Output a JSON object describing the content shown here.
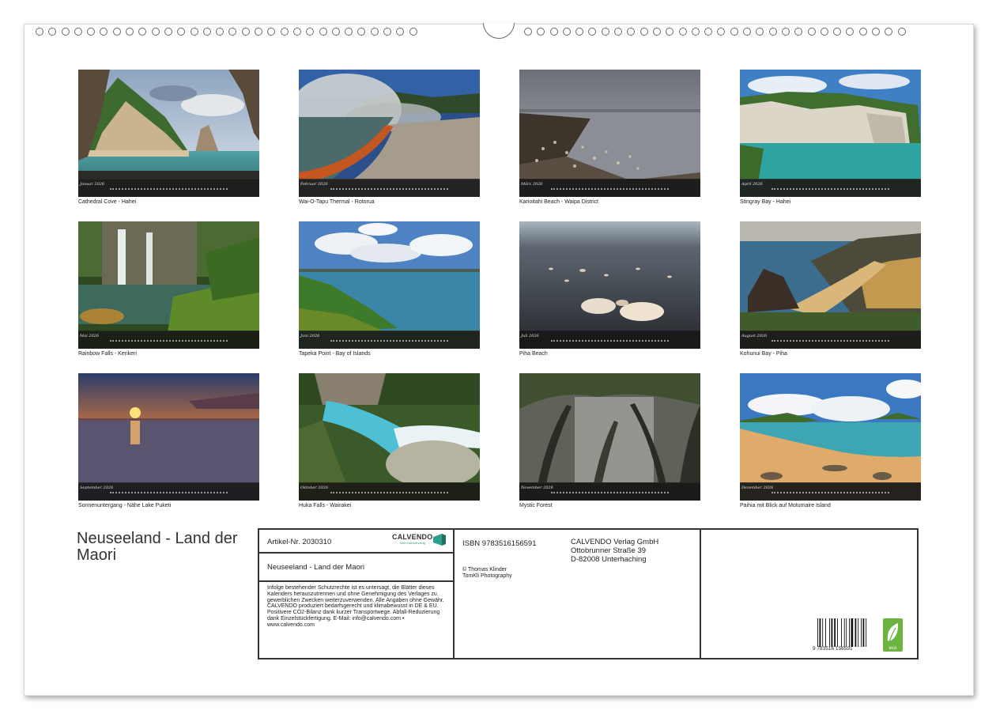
{
  "photos": [
    {
      "month": "Januar 2026",
      "caption": "Cathedral Cove - Hahei"
    },
    {
      "month": "Februar 2026",
      "caption": "Wai-O-Tapu Thermal - Rotorua"
    },
    {
      "month": "März 2026",
      "caption": "Karioitahi Beach - Waipa District"
    },
    {
      "month": "April 2026",
      "caption": "Stingray Bay - Hahei"
    },
    {
      "month": "Mai 2026",
      "caption": "Rainbow Falls - Kerikeri"
    },
    {
      "month": "Juni 2026",
      "caption": "Tapeka Point - Bay of Islands"
    },
    {
      "month": "Juli 2026",
      "caption": "Piha Beach"
    },
    {
      "month": "August 2026",
      "caption": "Kohunui Bay - Piha"
    },
    {
      "month": "September 2026",
      "caption": "Sonnenuntergang - Nähe Lake Puketi"
    },
    {
      "month": "Oktober 2026",
      "caption": "Huka Falls - Wairakei"
    },
    {
      "month": "November 2026",
      "caption": "Mystic Forest"
    },
    {
      "month": "Dezember 2026",
      "caption": "Paihia mit Blick auf Motumaire Island"
    }
  ],
  "calendar_title": "Neuseeland - Land der Maori",
  "info": {
    "article": "Artikel-Nr. 2030310",
    "logo": "CALVENDO",
    "logo_tagline": "Mein Kalenderverlag",
    "product_title": "Neuseeland - Land der Maori",
    "legal_text": "Infolge bestehender Schutzrechte ist es untersagt, die Blätter dieses Kalenders herauszutrennen und ohne Genehmigung des Verlages zu gewerblichen Zwecken weiterzuverwenden. Alle Angaben ohne Gewähr. CALVENDO produziert bedarfsgerecht und klimabewusst in DE & EU. Positivere CO2-Bilanz dank kurzer Transportwege. Abfall-Reduzierung dank Einzelstückfertigung. E-Mail: info@calvendo.com • www.calvendo.com",
    "isbn": "ISBN 9783516156591",
    "copyright": "© Thomas Klinder",
    "photographer": "TomKli Photography",
    "publisher_name": "CALVENDO Verlag GmbH",
    "publisher_street": "Ottobrunner Straße 39",
    "publisher_city": "D-82008 Unterhaching",
    "barcode_digits": "9  783516  156591",
    "eco_label": "eco"
  }
}
